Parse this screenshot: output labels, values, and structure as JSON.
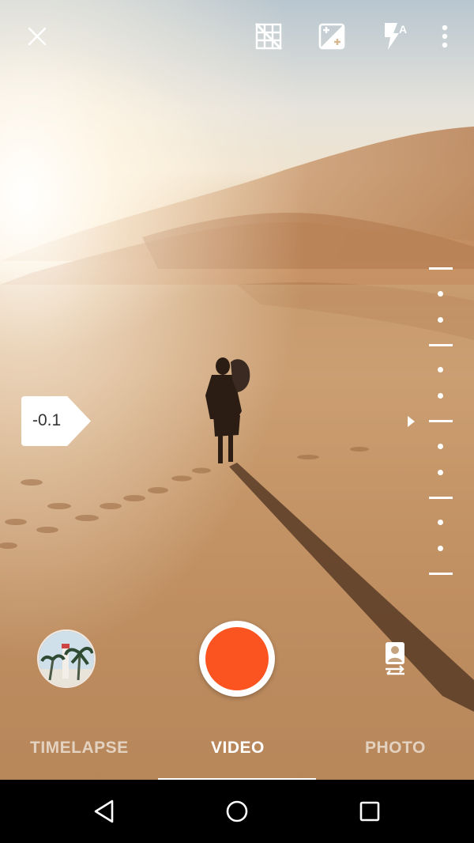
{
  "toolbar": {
    "close_icon": "close-icon",
    "grid_icon": "grid-off-icon",
    "exposure_icon": "exposure-icon",
    "flash_icon": "flash-auto-icon",
    "menu_icon": "more-vert-icon"
  },
  "exposure": {
    "value_label": "-0.1",
    "value": -0.1
  },
  "scale": {
    "pointer_position": "center"
  },
  "controls": {
    "gallery_icon": "gallery-thumbnail",
    "shutter_icon": "record-button",
    "switch_icon": "switch-camera-icon"
  },
  "modes": {
    "items": [
      "TIMELAPSE",
      "VIDEO",
      "PHOTO"
    ],
    "active": "VIDEO"
  },
  "colors": {
    "record_accent": "#fc5421",
    "overlay": "#ffffff"
  },
  "navbar": {
    "back_icon": "back-icon",
    "home_icon": "home-icon",
    "recents_icon": "recents-icon"
  }
}
